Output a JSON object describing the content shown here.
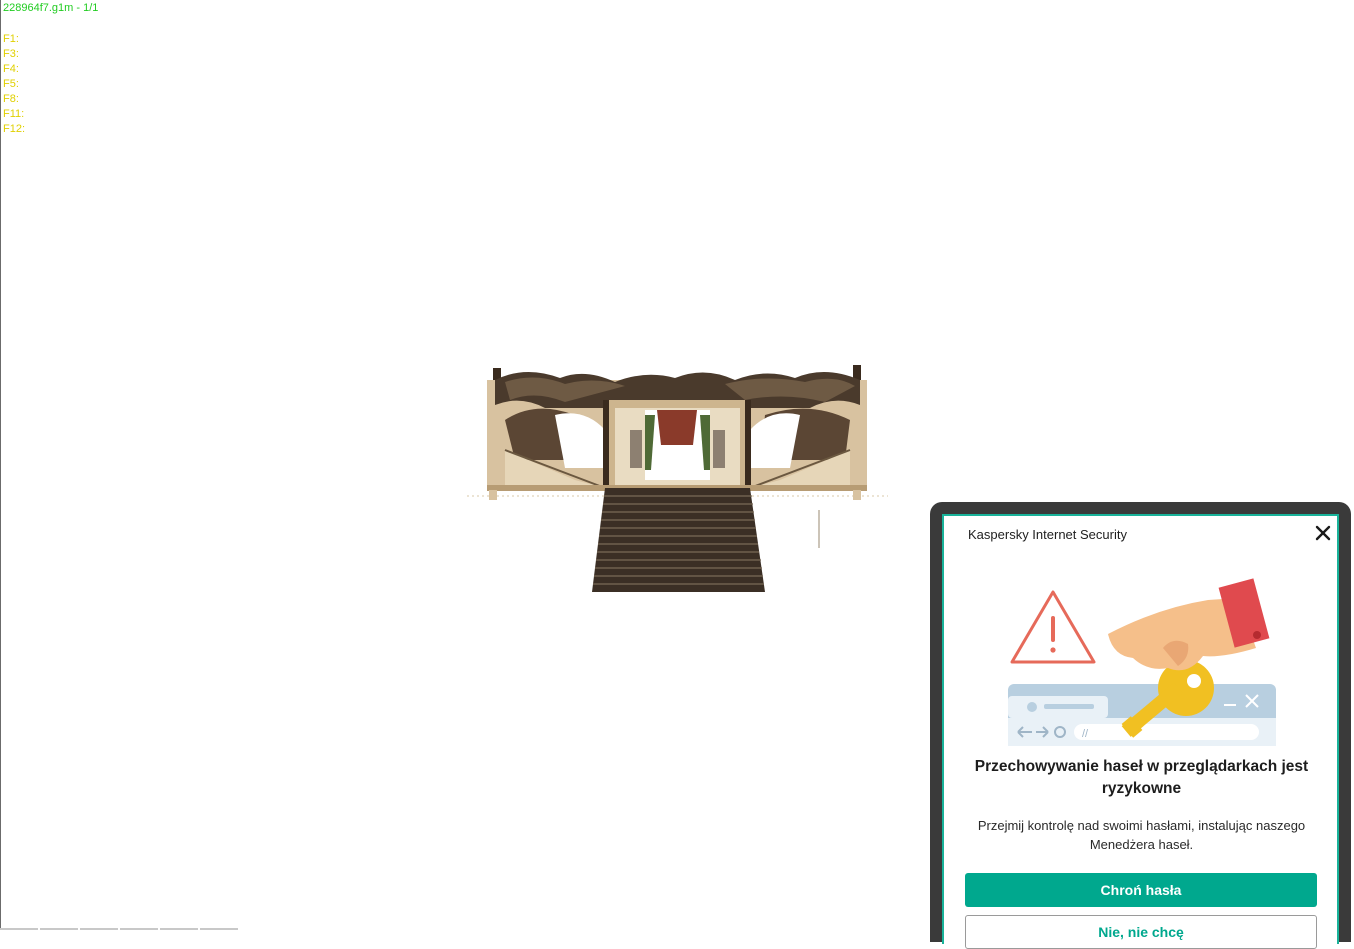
{
  "viewer": {
    "title": "228964f7.g1m - 1/1",
    "keys": [
      "F1:",
      "F3:",
      "F4:",
      "F5:",
      "F8:",
      "F11:",
      "F12:"
    ]
  },
  "popup": {
    "app_title": "Kaspersky Internet Security",
    "heading": "Przechowywanie haseł w przeglądarkach jest ryzykowne",
    "body": "Przejmij kontrolę nad swoimi hasłami, instalując naszego Menedżera haseł.",
    "primary_button": "Chroń hasła",
    "secondary_button": "Nie, nie chcę",
    "accent_color": "#00a88e",
    "frame_color": "#19b39a"
  }
}
